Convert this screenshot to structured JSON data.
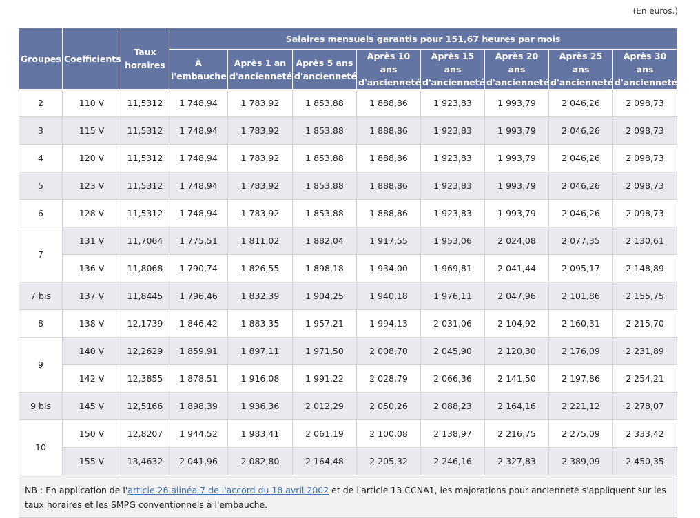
{
  "unit_note": "(En euros.)",
  "headers": {
    "groupes": "Groupes",
    "coefficients": "Coefficients",
    "taux_line1": "Taux",
    "taux_line2": "horaires",
    "salaires": "Salaires mensuels garantis pour 151,67 heures par mois",
    "columns": [
      [
        "À",
        "l'embauche"
      ],
      [
        "Après 1 an",
        "d'ancienneté"
      ],
      [
        "Après 5 ans",
        "d'ancienneté"
      ],
      [
        "Après 10 ans",
        "d'ancienneté"
      ],
      [
        "Après 15 ans",
        "d'ancienneté"
      ],
      [
        "Après 20 ans",
        "d'ancienneté"
      ],
      [
        "Après 25 ans",
        "d'ancienneté"
      ],
      [
        "Après 30 ans",
        "d'ancienneté"
      ]
    ]
  },
  "rows": [
    {
      "group": "2",
      "coef": "110 V",
      "taux": "11,5312",
      "values": [
        "1 748,94",
        "1 783,92",
        "1 853,88",
        "1 888,86",
        "1 923,83",
        "1 993,79",
        "2 046,26",
        "2 098,73"
      ]
    },
    {
      "group": "3",
      "coef": "115 V",
      "taux": "11,5312",
      "values": [
        "1 748,94",
        "1 783,92",
        "1 853,88",
        "1 888,86",
        "1 923,83",
        "1 993,79",
        "2 046,26",
        "2 098,73"
      ]
    },
    {
      "group": "4",
      "coef": "120 V",
      "taux": "11,5312",
      "values": [
        "1 748,94",
        "1 783,92",
        "1 853,88",
        "1 888,86",
        "1 923,83",
        "1 993,79",
        "2 046,26",
        "2 098,73"
      ]
    },
    {
      "group": "5",
      "coef": "123 V",
      "taux": "11,5312",
      "values": [
        "1 748,94",
        "1 783,92",
        "1 853,88",
        "1 888,86",
        "1 923,83",
        "1 993,79",
        "2 046,26",
        "2 098,73"
      ]
    },
    {
      "group": "6",
      "coef": "128 V",
      "taux": "11,5312",
      "values": [
        "1 748,94",
        "1 783,92",
        "1 853,88",
        "1 888,86",
        "1 923,83",
        "1 993,79",
        "2 046,26",
        "2 098,73"
      ]
    },
    {
      "group": "7",
      "coef": "131 V",
      "taux": "11,7064",
      "values": [
        "1 775,51",
        "1 811,02",
        "1 882,04",
        "1 917,55",
        "1 953,06",
        "2 024,08",
        "2 077,35",
        "2 130,61"
      ]
    },
    {
      "group": "",
      "coef": "136 V",
      "taux": "11,8068",
      "values": [
        "1 790,74",
        "1 826,55",
        "1 898,18",
        "1 934,00",
        "1 969,81",
        "2 041,44",
        "2 095,17",
        "2 148,89"
      ]
    },
    {
      "group": "7 bis",
      "coef": "137 V",
      "taux": "11,8445",
      "values": [
        "1 796,46",
        "1 832,39",
        "1 904,25",
        "1 940,18",
        "1 976,11",
        "2 047,96",
        "2 101,86",
        "2 155,75"
      ]
    },
    {
      "group": "8",
      "coef": "138 V",
      "taux": "12,1739",
      "values": [
        "1 846,42",
        "1 883,35",
        "1 957,21",
        "1 994,13",
        "2 031,06",
        "2 104,92",
        "2 160,31",
        "2 215,70"
      ]
    },
    {
      "group": "9",
      "coef": "140 V",
      "taux": "12,2629",
      "values": [
        "1 859,91",
        "1 897,11",
        "1 971,50",
        "2 008,70",
        "2 045,90",
        "2 120,30",
        "2 176,09",
        "2 231,89"
      ]
    },
    {
      "group": "",
      "coef": "142 V",
      "taux": "12,3855",
      "values": [
        "1 878,51",
        "1 916,08",
        "1 991,22",
        "2 028,79",
        "2 066,36",
        "2 141,50",
        "2 197,86",
        "2 254,21"
      ]
    },
    {
      "group": "9 bis",
      "coef": "145 V",
      "taux": "12,5166",
      "values": [
        "1 898,39",
        "1 936,36",
        "2 012,29",
        "2 050,26",
        "2 088,23",
        "2 164,16",
        "2 221,12",
        "2 278,07"
      ]
    },
    {
      "group": "10",
      "coef": "150 V",
      "taux": "12,8207",
      "values": [
        "1 944,52",
        "1 983,41",
        "2 061,19",
        "2 100,08",
        "2 138,97",
        "2 216,75",
        "2 275,09",
        "2 333,42"
      ]
    },
    {
      "group": "",
      "coef": "155 V",
      "taux": "13,4632",
      "values": [
        "2 041,96",
        "2 082,80",
        "2 164,48",
        "2 205,32",
        "2 246,16",
        "2 327,83",
        "2 389,09",
        "2 450,35"
      ]
    }
  ],
  "note": {
    "before": "NB : En application de l'",
    "link": "article 26 alinéa 7 de l'accord du 18 avril 2002",
    "after": " et de l'article 13 CCNA1, les majorations pour ancienneté s'appliquent sur les taux horaires et les SMPG conventionnels à l'embauche."
  },
  "colors": {
    "header_bg": "#6474a3",
    "row_shade": "#e9e9ee",
    "link": "#3a6fb0"
  }
}
